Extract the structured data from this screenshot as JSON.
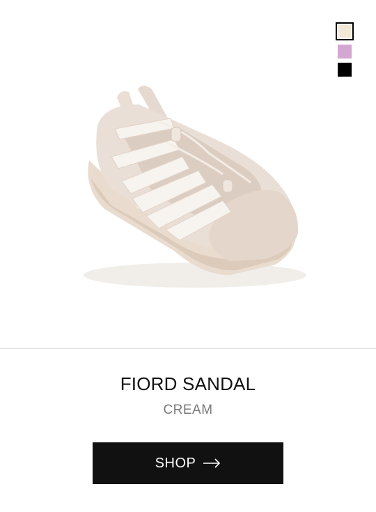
{
  "product": {
    "name": "FIORD SANDAL",
    "color": "CREAM",
    "image_icon": "sandal-product-image"
  },
  "swatches": [
    {
      "name": "cream",
      "color": "#f3e7d6",
      "selected": true
    },
    {
      "name": "lilac",
      "color": "#d4a6d2",
      "selected": false
    },
    {
      "name": "black",
      "color": "#000000",
      "selected": false
    }
  ],
  "cta": {
    "label": "SHOP",
    "icon": "arrow-right-icon"
  }
}
